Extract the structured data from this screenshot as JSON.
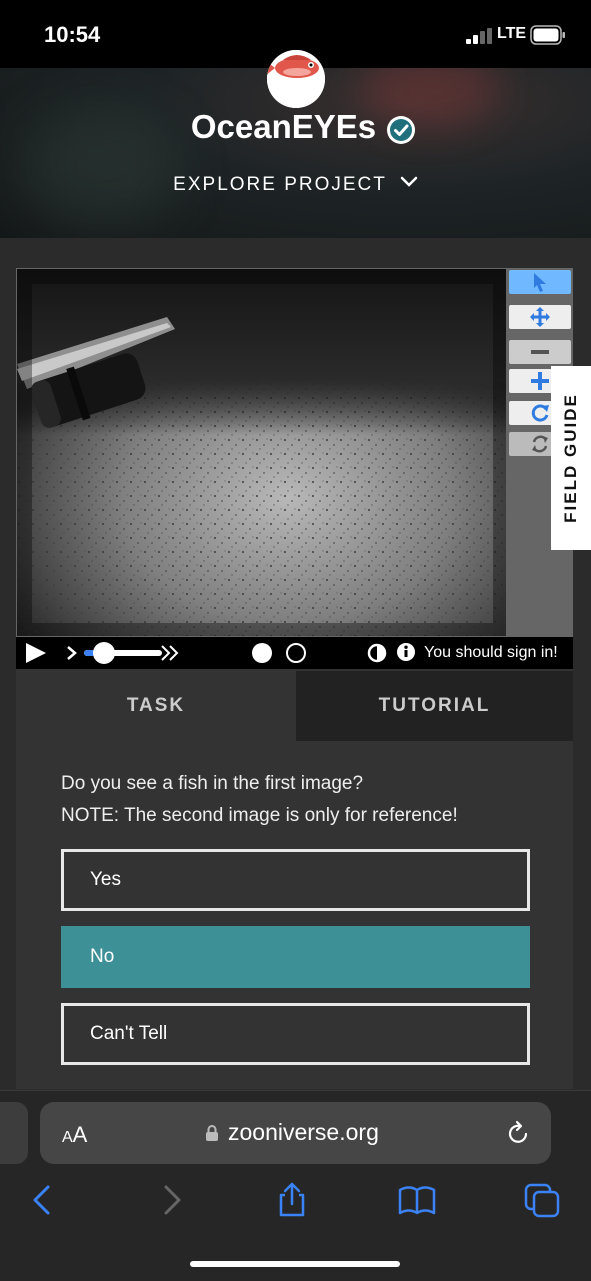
{
  "status_bar": {
    "time": "10:54",
    "network": "LTE"
  },
  "project": {
    "title": "OceanEYEs",
    "explore_label": "EXPLORE PROJECT"
  },
  "viewer": {
    "controls": {
      "signin_text": "You should sign in!"
    },
    "field_guide_label": "FIELD GUIDE"
  },
  "task_panel": {
    "tabs": [
      {
        "label": "TASK",
        "active": true
      },
      {
        "label": "TUTORIAL",
        "active": false
      }
    ],
    "question_line1": "Do you see a fish in the first image?",
    "question_line2": "NOTE: The second image is only for reference!",
    "answers": [
      {
        "label": "Yes",
        "selected": false
      },
      {
        "label": "No",
        "selected": true
      },
      {
        "label": "Can't Tell",
        "selected": false
      }
    ]
  },
  "browser": {
    "text_size_label_small": "A",
    "text_size_label_large": "A",
    "url": "zooniverse.org"
  },
  "colors": {
    "selected_answer": "#3d9096",
    "active_tool": "#70b8ff",
    "tool_icon": "#2f7be0",
    "safari_accent": "#3b82f6"
  }
}
